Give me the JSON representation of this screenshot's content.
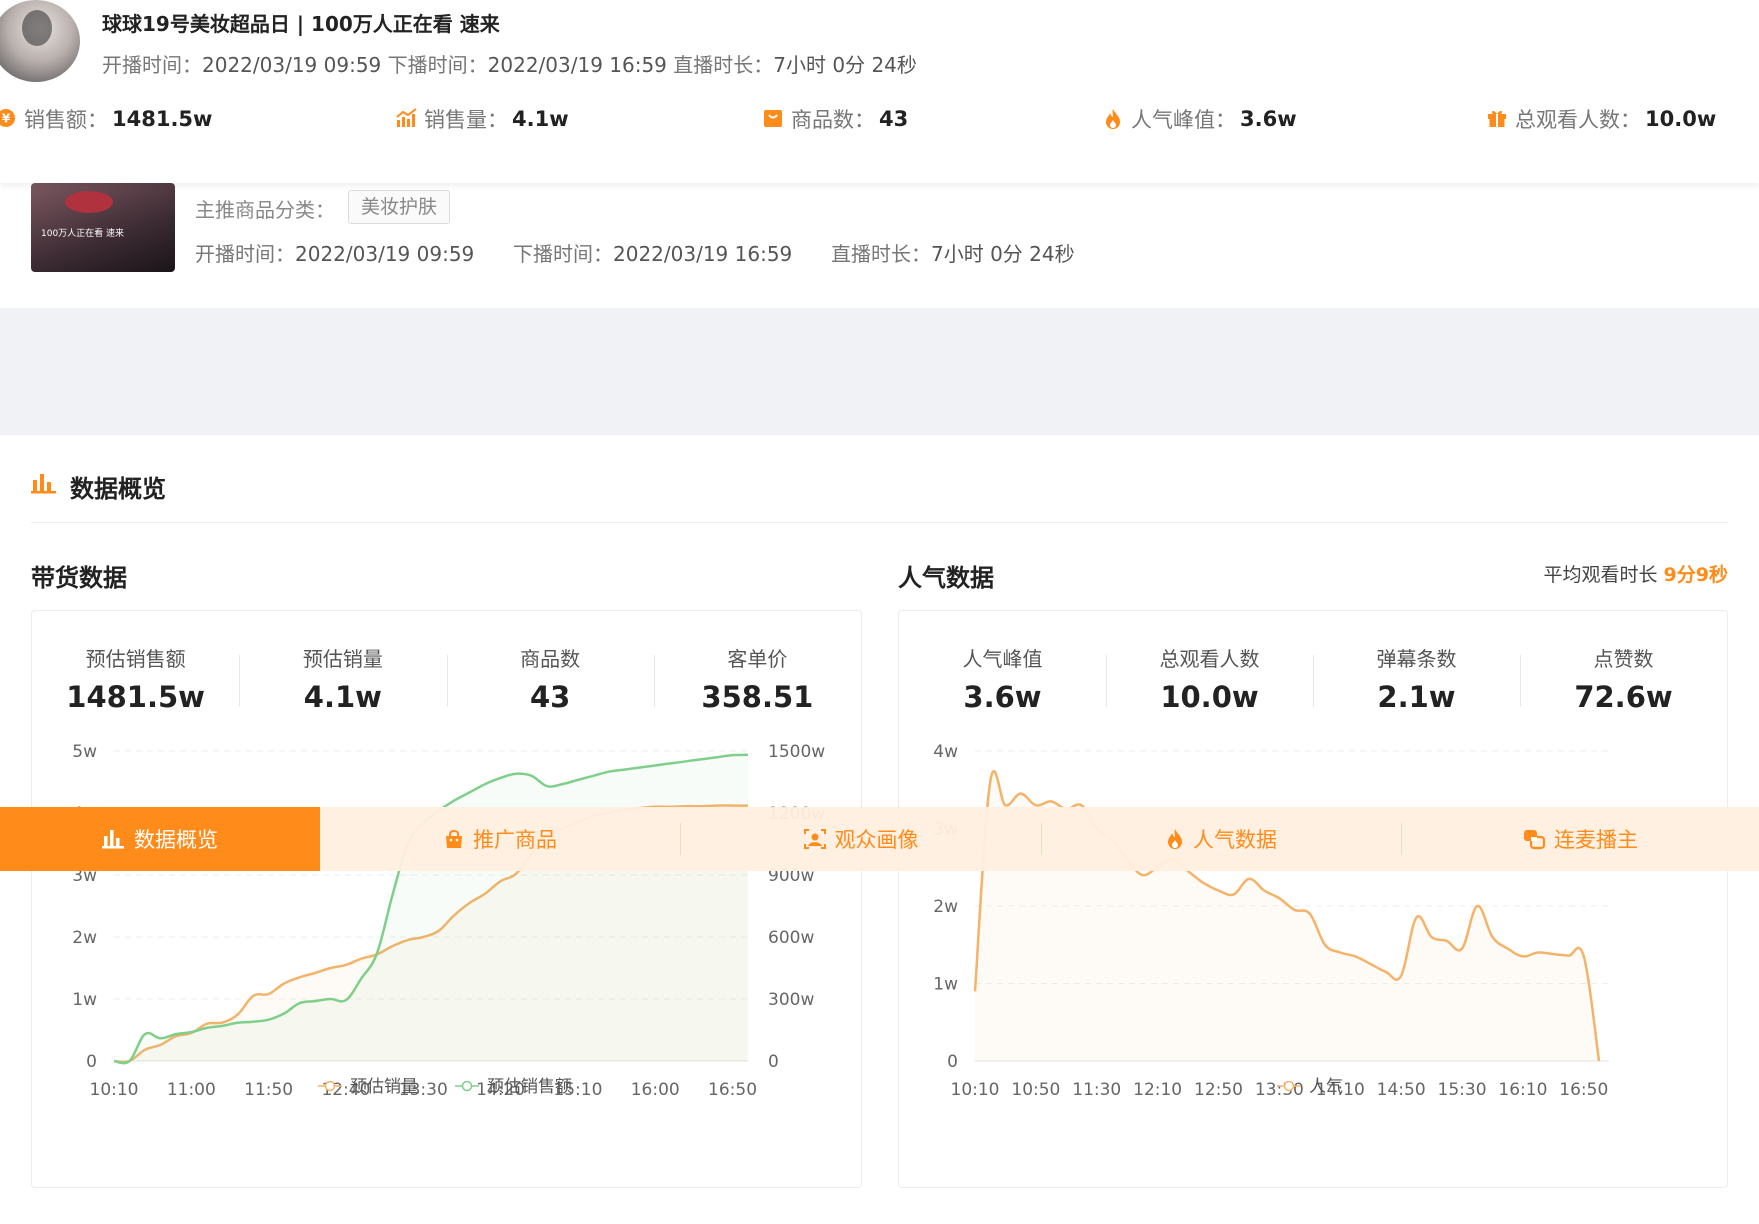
{
  "header": {
    "title": "球球19号美妆超品日 | 100万人正在看 速来",
    "start_label": "开播时间：",
    "start_time": "2022/03/19 09:59",
    "end_label": "下播时间：",
    "end_time": "2022/03/19 16:59",
    "duration_label": "直播时长：",
    "duration": "7小时 0分 24秒",
    "stats": [
      {
        "icon": "yen-coin-icon",
        "label": "销售额：",
        "value": "1481.5w"
      },
      {
        "icon": "bar-trend-icon",
        "label": "销售量：",
        "value": "4.1w"
      },
      {
        "icon": "shopping-bag-icon",
        "label": "商品数：",
        "value": "43"
      },
      {
        "icon": "flame-icon",
        "label": "人气峰值：",
        "value": "3.6w"
      },
      {
        "icon": "gift-icon",
        "label": "总观看人数：",
        "value": "10.0w"
      }
    ]
  },
  "info": {
    "cover_caption": "100万人正在看 速来",
    "category_label": "主推商品分类：",
    "category_tag": "美妆护肤",
    "start_label": "开播时间：",
    "start_time": "2022/03/19 09:59",
    "end_label": "下播时间：",
    "end_time": "2022/03/19 16:59",
    "duration_label": "直播时长：",
    "duration": "7小时 0分 24秒"
  },
  "overview": {
    "title": "数据概览"
  },
  "sales": {
    "title": "带货数据",
    "kpis": [
      {
        "label": "预估销售额",
        "value": "1481.5w"
      },
      {
        "label": "预估销量",
        "value": "4.1w"
      },
      {
        "label": "商品数",
        "value": "43"
      },
      {
        "label": "客单价",
        "value": "358.51"
      }
    ]
  },
  "popularity": {
    "title": "人气数据",
    "avg_label": "平均观看时长",
    "avg_value": "9分9秒",
    "kpis": [
      {
        "label": "人气峰值",
        "value": "3.6w"
      },
      {
        "label": "总观看人数",
        "value": "10.0w"
      },
      {
        "label": "弹幕条数",
        "value": "2.1w"
      },
      {
        "label": "点赞数",
        "value": "72.6w"
      }
    ]
  },
  "tabs": [
    {
      "label": "数据概览",
      "icon": "bar-chart-icon",
      "active": true
    },
    {
      "label": "推广商品",
      "icon": "shopping-bag-icon",
      "active": false
    },
    {
      "label": "观众画像",
      "icon": "portrait-icon",
      "active": false
    },
    {
      "label": "人气数据",
      "icon": "flame-icon",
      "active": false
    },
    {
      "label": "连麦播主",
      "icon": "link-icon",
      "active": false
    }
  ],
  "colors": {
    "accent": "#ff8c1a",
    "volume_line": "#f5b36a",
    "amount_line": "#7fcf8a",
    "popularity_line": "#f5b36a"
  },
  "chart_data": [
    {
      "type": "line",
      "x": [
        "10:10",
        "10:20",
        "10:30",
        "10:40",
        "10:50",
        "11:00",
        "11:10",
        "11:20",
        "11:30",
        "11:40",
        "11:50",
        "12:00",
        "12:10",
        "12:20",
        "12:30",
        "12:40",
        "12:50",
        "13:00",
        "13:10",
        "13:20",
        "13:30",
        "13:40",
        "13:50",
        "14:00",
        "14:10",
        "14:20",
        "14:30",
        "14:40",
        "14:50",
        "15:00",
        "15:10",
        "15:20",
        "15:30",
        "15:40",
        "15:50",
        "16:00",
        "16:10",
        "16:20",
        "16:30",
        "16:40",
        "16:50",
        "17:00"
      ],
      "xticks": [
        "10:10",
        "11:00",
        "11:50",
        "12:40",
        "13:30",
        "14:20",
        "15:10",
        "16:00",
        "16:50"
      ],
      "y_left_ticks": [
        "0",
        "1w",
        "2w",
        "3w",
        "4w",
        "5w"
      ],
      "y_right_ticks": [
        "0",
        "300w",
        "600w",
        "900w",
        "1200w",
        "1500w"
      ],
      "ylim_left": [
        0,
        50000
      ],
      "ylim_right": [
        0,
        1500
      ],
      "legend_position": "bottom-center",
      "series": [
        {
          "name": "预估销量",
          "axis": "left",
          "values": [
            0,
            0,
            1800,
            2600,
            4000,
            4500,
            6000,
            6200,
            7500,
            10500,
            10800,
            12500,
            13500,
            14200,
            15000,
            15500,
            16500,
            17200,
            18500,
            19500,
            20000,
            21000,
            23500,
            25500,
            27000,
            29000,
            30200,
            33500,
            36500,
            37500,
            38500,
            39500,
            40000,
            40500,
            40800,
            41000,
            41000,
            41100,
            41100,
            41200,
            41200,
            41200
          ]
        },
        {
          "name": "预估销售额",
          "axis": "right",
          "values": [
            0,
            0,
            130,
            110,
            130,
            140,
            160,
            170,
            185,
            190,
            200,
            230,
            280,
            290,
            300,
            295,
            400,
            520,
            800,
            1050,
            1150,
            1210,
            1260,
            1300,
            1340,
            1370,
            1390,
            1380,
            1330,
            1340,
            1360,
            1380,
            1400,
            1410,
            1420,
            1430,
            1440,
            1450,
            1460,
            1470,
            1480,
            1481.5
          ]
        }
      ]
    },
    {
      "type": "line",
      "x": [
        "10:10",
        "10:20",
        "10:30",
        "10:40",
        "10:50",
        "11:00",
        "11:10",
        "11:20",
        "11:30",
        "11:40",
        "11:50",
        "12:00",
        "12:10",
        "12:20",
        "12:30",
        "12:40",
        "12:50",
        "13:00",
        "13:10",
        "13:20",
        "13:30",
        "13:40",
        "13:50",
        "14:00",
        "14:10",
        "14:20",
        "14:30",
        "14:40",
        "14:50",
        "15:00",
        "15:10",
        "15:20",
        "15:30",
        "15:40",
        "15:50",
        "16:00",
        "16:10",
        "16:20",
        "16:30",
        "16:40",
        "16:50",
        "17:00"
      ],
      "xticks": [
        "10:10",
        "10:50",
        "11:30",
        "12:10",
        "12:50",
        "13:30",
        "14:10",
        "14:50",
        "15:30",
        "16:10",
        "16:50"
      ],
      "y_ticks": [
        "0",
        "1w",
        "2w",
        "3w",
        "4w"
      ],
      "ylim": [
        0,
        40000
      ],
      "legend_position": "bottom-center",
      "series": [
        {
          "name": "人气",
          "values": [
            9000,
            36000,
            33000,
            34500,
            33000,
            33500,
            32500,
            33000,
            30000,
            28500,
            26000,
            24000,
            25000,
            26000,
            24500,
            23000,
            22000,
            21500,
            23500,
            22000,
            21000,
            19500,
            19000,
            15000,
            14000,
            13500,
            12500,
            11500,
            11000,
            18500,
            16000,
            15500,
            14500,
            20000,
            16000,
            14500,
            13500,
            14000,
            13800,
            13600,
            13500,
            0
          ]
        }
      ]
    }
  ]
}
